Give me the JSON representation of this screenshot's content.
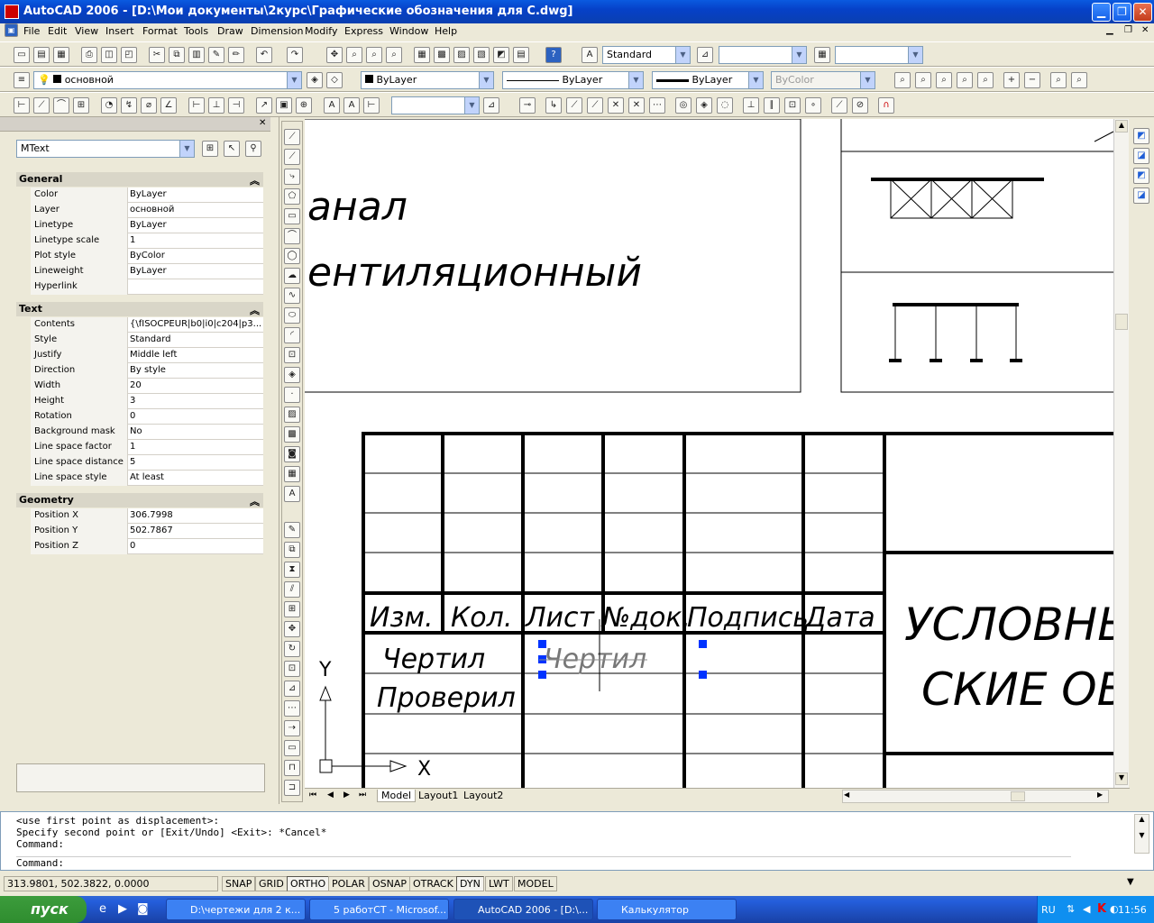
{
  "window": {
    "title": "AutoCAD 2006 - [D:\\Мои документы\\2курс\\Графические обозначения для С.dwg]"
  },
  "menu": [
    "File",
    "Edit",
    "View",
    "Insert",
    "Format",
    "Tools",
    "Draw",
    "Dimension",
    "Modify",
    "Express",
    "Window",
    "Help"
  ],
  "toolbar": {
    "text_style": "Standard",
    "layer": "основной",
    "color": "ByLayer",
    "linetype": "ByLayer",
    "lineweight": "ByLayer",
    "plotstyle": "ByColor"
  },
  "properties": {
    "selection": "MText",
    "sections": {
      "general": "General",
      "text": "Text",
      "geometry": "Geometry"
    },
    "general": [
      {
        "k": "Color",
        "v": "ByLayer"
      },
      {
        "k": "Layer",
        "v": "основной"
      },
      {
        "k": "Linetype",
        "v": "ByLayer"
      },
      {
        "k": "Linetype scale",
        "v": "1"
      },
      {
        "k": "Plot style",
        "v": "ByColor"
      },
      {
        "k": "Lineweight",
        "v": "ByLayer"
      },
      {
        "k": "Hyperlink",
        "v": ""
      }
    ],
    "text": [
      {
        "k": "Contents",
        "v": "{\\fISOCPEUR|b0|i0|c204|p3..."
      },
      {
        "k": "Style",
        "v": "Standard"
      },
      {
        "k": "Justify",
        "v": "Middle left"
      },
      {
        "k": "Direction",
        "v": "By style"
      },
      {
        "k": "Width",
        "v": "20"
      },
      {
        "k": "Height",
        "v": "3"
      },
      {
        "k": "Rotation",
        "v": "0"
      },
      {
        "k": "Background mask",
        "v": "No"
      },
      {
        "k": "Line space factor",
        "v": "1"
      },
      {
        "k": "Line space distance",
        "v": "5"
      },
      {
        "k": "Line space style",
        "v": "At least"
      }
    ],
    "geometry": [
      {
        "k": "Position X",
        "v": "306.7998"
      },
      {
        "k": "Position Y",
        "v": "502.7867"
      },
      {
        "k": "Position Z",
        "v": "0"
      }
    ]
  },
  "drawing": {
    "text_line1": "анал",
    "text_line2": "ентиляционный",
    "headers": [
      "Изм.",
      "Кол.",
      "Лист",
      "№док.",
      "Подпись",
      "Дата"
    ],
    "row1": "Чертил",
    "row2": "Проверил",
    "ghost": "Чертил",
    "title1": "УСЛОВНЫ",
    "title2": "СКИЕ ОБ",
    "ucs_x": "X",
    "ucs_y": "Y"
  },
  "tabs": [
    "Model",
    "Layout1",
    "Layout2"
  ],
  "command": {
    "lines": [
      "<use first point as displacement>:",
      "Specify second point or [Exit/Undo] <Exit>: *Cancel*",
      "Command:"
    ],
    "prompt": "Command:"
  },
  "status": {
    "coords": "313.9801, 502.3822, 0.0000",
    "toggles": [
      "SNAP",
      "GRID",
      "ORTHO",
      "POLAR",
      "OSNAP",
      "OTRACK",
      "DYN",
      "LWT",
      "MODEL"
    ]
  },
  "taskbar": {
    "start": "пуск",
    "tasks": [
      "D:\\чертежи для 2 к...",
      "5 работСТ - Microsof...",
      "AutoCAD 2006 - [D:\\...",
      "Калькулятор"
    ],
    "lang": "RU",
    "clock": "11:56"
  }
}
